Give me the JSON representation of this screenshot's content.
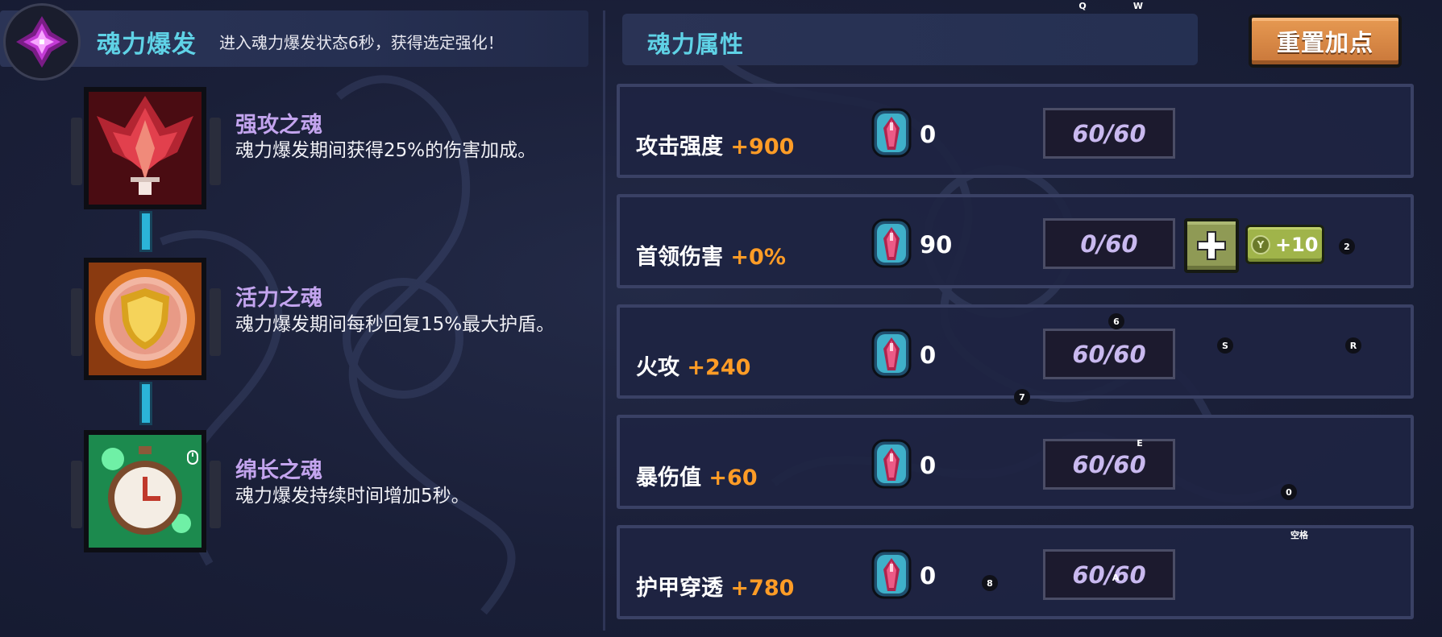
{
  "soul_burst": {
    "title": "魂力爆发",
    "subtitle": "进入魂力爆发状态6秒，获得选定强化！"
  },
  "skills": [
    {
      "name": "强攻之魂",
      "desc": "魂力爆发期间获得25%的伤害加成。"
    },
    {
      "name": "活力之魂",
      "desc": "魂力爆发期间每秒回复15%最大护盾。"
    },
    {
      "name": "绵长之魂",
      "desc": "魂力爆发持续时间增加5秒。"
    }
  ],
  "attributes_panel": {
    "title": "魂力属性",
    "reset_label": "重置加点"
  },
  "attributes": [
    {
      "name": "攻击强度",
      "bonus": "+900",
      "gems": "0",
      "level": "60/60"
    },
    {
      "name": "首领伤害",
      "bonus": "+0%",
      "gems": "90",
      "level": "0/60",
      "plus10_label": "+10",
      "plus10_key": "Y"
    },
    {
      "name": "火攻",
      "bonus": "+240",
      "gems": "0",
      "level": "60/60"
    },
    {
      "name": "暴伤值",
      "bonus": "+60",
      "gems": "0",
      "level": "60/60"
    },
    {
      "name": "护甲穿透",
      "bonus": "+780",
      "gems": "0",
      "level": "60/60"
    }
  ],
  "key_hints": [
    "Q",
    "W",
    "2",
    "6",
    "S",
    "R",
    "7",
    "E",
    "0",
    "空格",
    "8",
    "A"
  ],
  "colors": {
    "title_cyan": "#5fd2e6",
    "skill_name_purple": "#c3a4ee",
    "bonus_orange": "#ff9c26",
    "reset_button": "#d98845",
    "plus_button": "#8f9a55"
  },
  "icons": {
    "header": "soul-crystal-icon",
    "skill_1": "flame-soul-icon",
    "skill_2": "shield-soul-icon",
    "skill_3": "stopwatch-soul-icon",
    "gem": "soul-gem-icon"
  }
}
